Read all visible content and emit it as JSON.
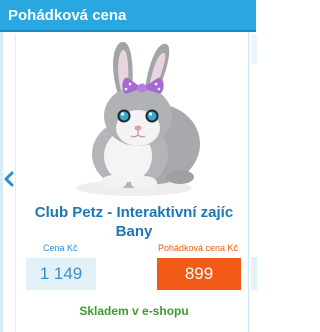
{
  "header": {
    "title": "Pohádková cena"
  },
  "product": {
    "name": "Club Petz - Interaktivní zajíc Bany",
    "image_icon": "bunny-plush-image",
    "regular_price_label": "Cena Kč",
    "regular_price": "1 149",
    "fairy_price_label": "Pohádková cena Kč",
    "fairy_price": "899",
    "availability": "Skladem v e-shopu"
  },
  "navigation": {
    "prev_icon": "chevron-left-icon"
  },
  "colors": {
    "header_bg": "#2aa6e0",
    "title": "#1b78b8",
    "regular_price_bg": "#e2f0f7",
    "fairy_price_bg": "#f05a14",
    "stock": "#3e9a32"
  }
}
